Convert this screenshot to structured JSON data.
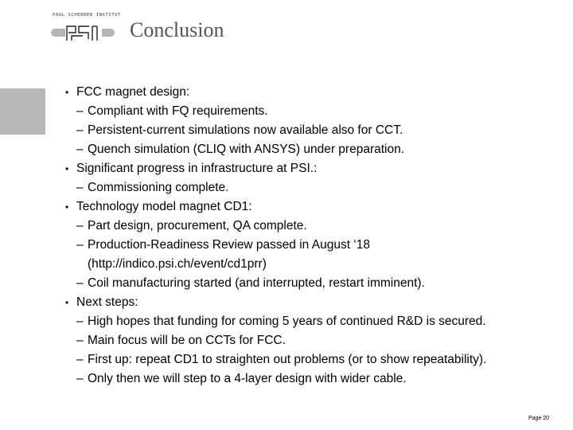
{
  "header": {
    "logo_text": "PAUL SCHERRER INSTITUT",
    "logo_mark": "PSI",
    "title": "Conclusion"
  },
  "bullets": [
    {
      "text": "FCC magnet design:",
      "subs": [
        "Compliant with FQ requirements.",
        "Persistent-current simulations now available also for CCT.",
        "Quench simulation (CLIQ with ANSYS) under preparation."
      ]
    },
    {
      "text": "Significant progress in infrastructure at PSI.:",
      "subs": [
        "Commissioning complete."
      ]
    },
    {
      "text": "Technology model magnet CD1:",
      "subs": [
        "Part design, procurement, QA complete.",
        "Production-Readiness Review passed in August ‘18",
        "(http://indico.psi.ch/event/cd1prr)",
        "Coil manufacturing started (and interrupted, restart imminent)."
      ]
    },
    {
      "text": "Next steps:",
      "subs": [
        "High hopes that funding for coming 5 years of continued R&D is secured.",
        "Main focus will be on CCTs for FCC.",
        "First up: repeat CD1 to straighten out problems (or to show repeatability).",
        "Only then we will step to a 4-layer design with wider cable."
      ]
    }
  ],
  "markers": {
    "bullet": "•",
    "dash": "–"
  },
  "footer": {
    "page_label": "Page 20"
  },
  "colors": {
    "title": "#555555",
    "side_block": "#b8b8b8",
    "logo_bar": "#b5b5b5"
  }
}
